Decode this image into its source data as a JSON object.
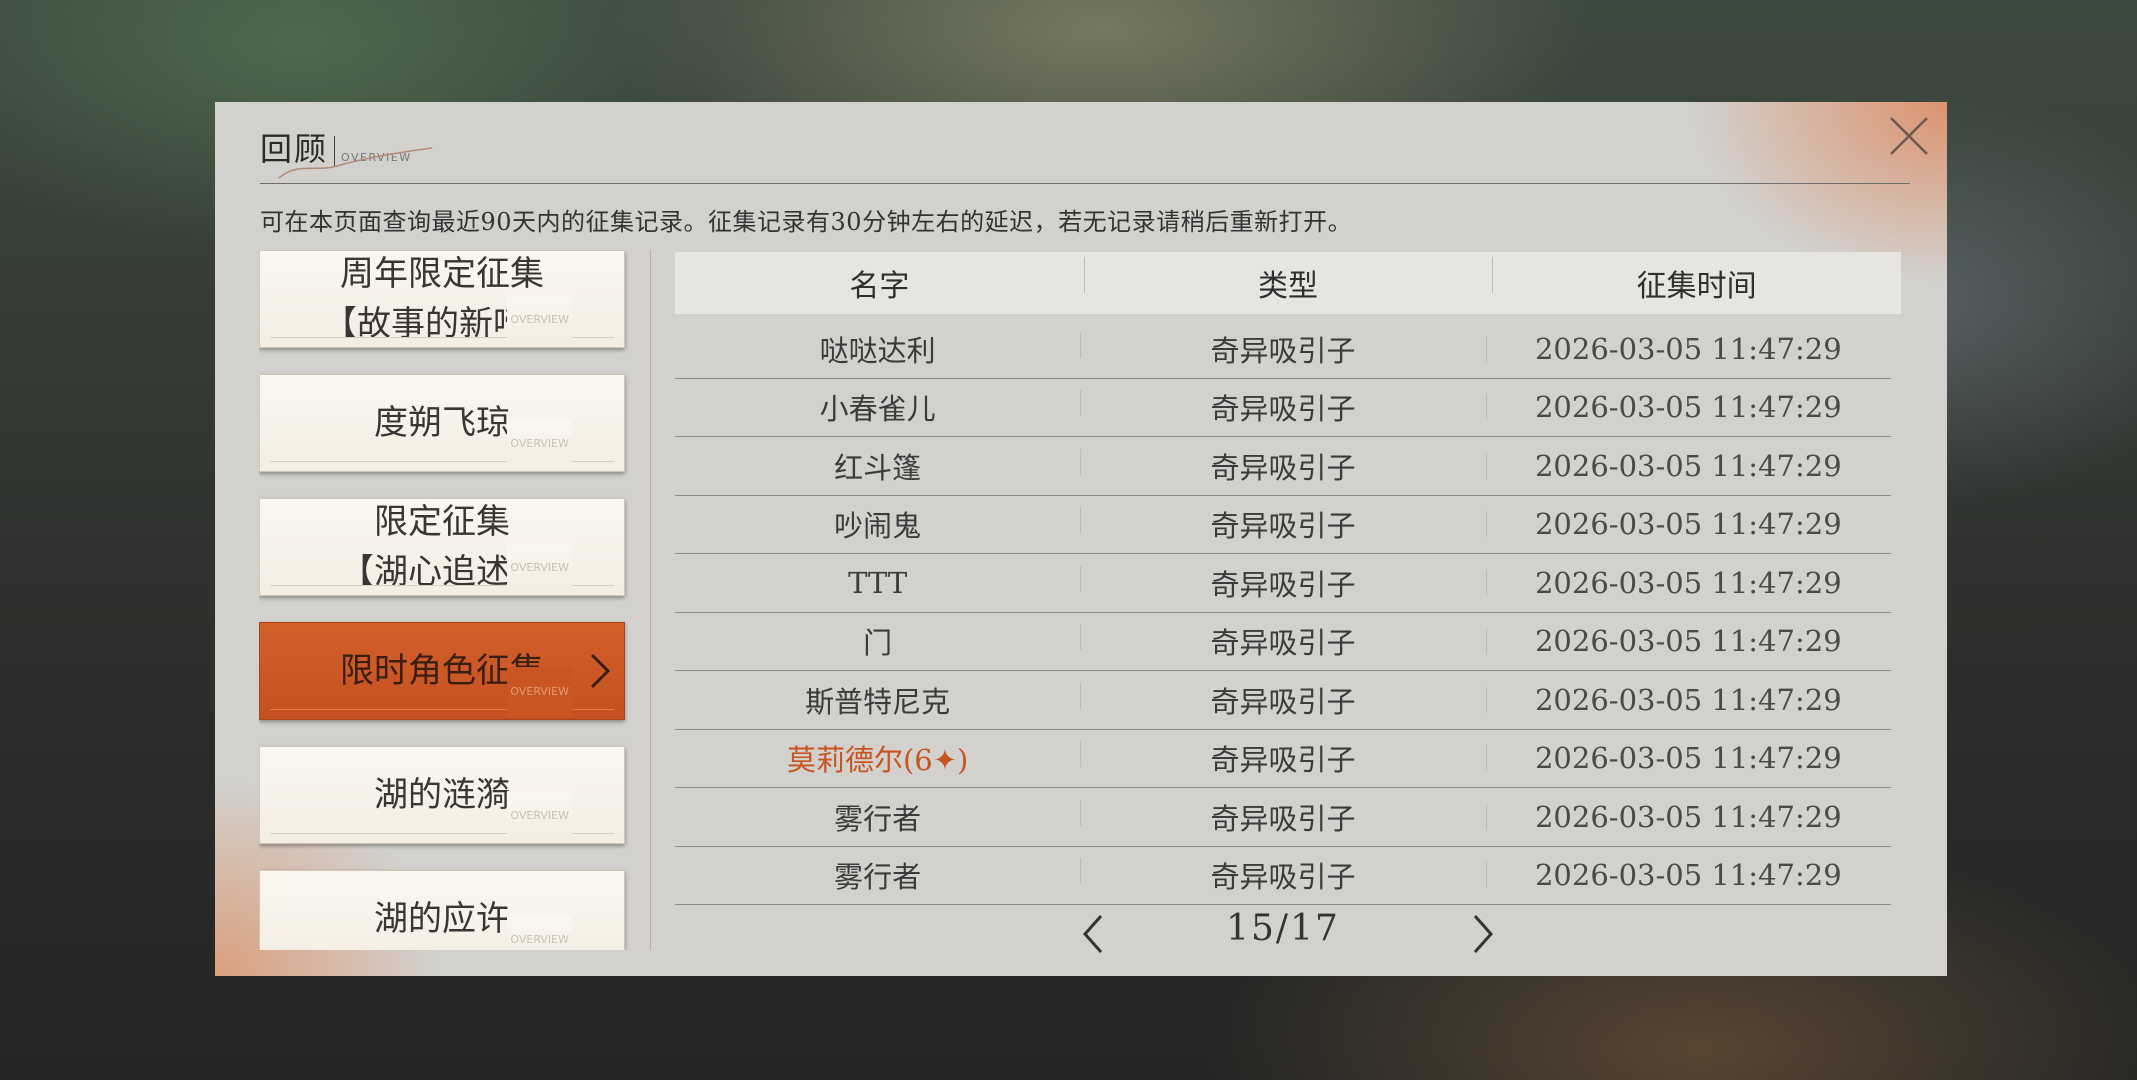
{
  "dialog": {
    "title": "回顾",
    "subtitle": "OVERVIEW",
    "notice": "可在本页面查询最近90天内的征集记录。征集记录有30分钟左右的延迟，若无记录请稍后重新打开。"
  },
  "sidebar": {
    "items": [
      {
        "label": "周年限定征集\n【故事的新啼】",
        "tag": "OVERVIEW",
        "active": false
      },
      {
        "label": "度朔飞琼",
        "tag": "OVERVIEW",
        "active": false
      },
      {
        "label": "限定征集\n【湖心追述】",
        "tag": "OVERVIEW",
        "active": false
      },
      {
        "label": "限时角色征集",
        "tag": "OVERVIEW",
        "active": true
      },
      {
        "label": "湖的涟漪",
        "tag": "OVERVIEW",
        "active": false
      },
      {
        "label": "湖的应许",
        "tag": "OVERVIEW",
        "active": false
      }
    ]
  },
  "table": {
    "headers": [
      "名字",
      "类型",
      "征集时间"
    ],
    "rows": [
      {
        "name": "哒哒达利",
        "type": "奇异吸引子",
        "time": "2026-03-05 11:47:29",
        "highlight": false
      },
      {
        "name": "小春雀儿",
        "type": "奇异吸引子",
        "time": "2026-03-05 11:47:29",
        "highlight": false
      },
      {
        "name": "红斗篷",
        "type": "奇异吸引子",
        "time": "2026-03-05 11:47:29",
        "highlight": false
      },
      {
        "name": "吵闹鬼",
        "type": "奇异吸引子",
        "time": "2026-03-05 11:47:29",
        "highlight": false
      },
      {
        "name": "TTT",
        "type": "奇异吸引子",
        "time": "2026-03-05 11:47:29",
        "highlight": false
      },
      {
        "name": "门",
        "type": "奇异吸引子",
        "time": "2026-03-05 11:47:29",
        "highlight": false
      },
      {
        "name": "斯普特尼克",
        "type": "奇异吸引子",
        "time": "2026-03-05 11:47:29",
        "highlight": false
      },
      {
        "name": "莫莉德尔(6✦)",
        "type": "奇异吸引子",
        "time": "2026-03-05 11:47:29",
        "highlight": true
      },
      {
        "name": "雾行者",
        "type": "奇异吸引子",
        "time": "2026-03-05 11:47:29",
        "highlight": false
      },
      {
        "name": "雾行者",
        "type": "奇异吸引子",
        "time": "2026-03-05 11:47:29",
        "highlight": false
      }
    ]
  },
  "pager": {
    "current": 15,
    "total": 17,
    "label": "15/17"
  },
  "colors": {
    "accent": "#c8541f",
    "highlight_text": "#c8541f",
    "panel": "#d2d1ce"
  },
  "icons": {
    "close": "close-icon",
    "prev": "chevron-left-icon",
    "next": "chevron-right-icon",
    "active_arrow": "chevron-right-icon"
  }
}
